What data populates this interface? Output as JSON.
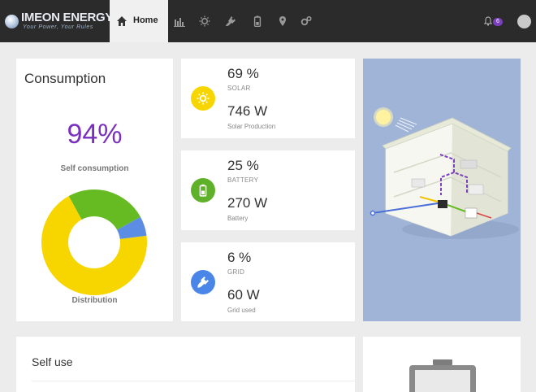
{
  "brand": {
    "name": "IMEON ENERGY",
    "tagline": "Your Power, Your Rules"
  },
  "nav": {
    "home_label": "Home",
    "icons": [
      "home-icon",
      "chart-icon",
      "sun-icon",
      "plug-icon",
      "battery-icon",
      "map-marker-icon",
      "cogs-icon"
    ],
    "notification_count": "6"
  },
  "consumption": {
    "title": "Consumption",
    "self_consumption_pct": "94%",
    "self_consumption_label": "Self consumption",
    "distribution_label": "Distribution",
    "distribution": [
      {
        "name": "solar",
        "value": 0.69,
        "color": "#f7d600"
      },
      {
        "name": "battery",
        "value": 0.25,
        "color": "#66bb22"
      },
      {
        "name": "grid",
        "value": 0.06,
        "color": "#5b8de5"
      }
    ]
  },
  "solar": {
    "pct": "69 %",
    "label": "SOLAR",
    "watts": "746 W",
    "desc": "Solar Production",
    "color": "#f7d600"
  },
  "battery": {
    "pct": "25 %",
    "label": "BATTERY",
    "watts": "270 W",
    "desc": "Battery",
    "color": "#5fb12a"
  },
  "grid": {
    "pct": "6 %",
    "label": "GRID",
    "watts": "60 W",
    "desc": "Grid used",
    "color": "#4a86e8"
  },
  "self_use": {
    "title": "Self use"
  }
}
